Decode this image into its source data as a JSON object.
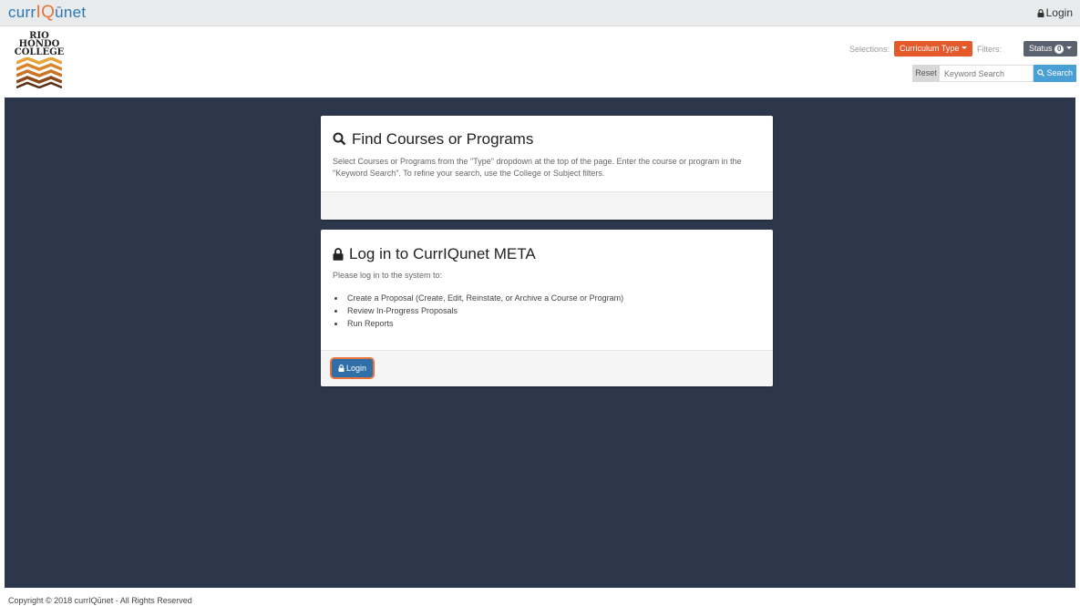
{
  "topbar": {
    "brand_prefix": "curr",
    "brand_accent": "IQ",
    "brand_suffix": "ūnet",
    "login_label": "Login"
  },
  "logo": {
    "line1": "RIO",
    "line2": "HONDO",
    "line3": "COLLEGE"
  },
  "toolbar": {
    "selections_label": "Selections:",
    "curriculum_type_label": "Curriculum Type",
    "filters_label": "Filters:",
    "status_label": "Status",
    "status_count": "0",
    "reset_label": "Reset",
    "search_placeholder": "Keyword Search",
    "search_label": "Search"
  },
  "find_card": {
    "title": "Find Courses or Programs",
    "body": "Select Courses or Programs from the \"Type\" dropdown at the top of the page. Enter the course or program in the \"Keyword Search\". To refine your search, use the College or Subject filters."
  },
  "login_card": {
    "title": "Log in to CurrIQunet META",
    "intro": "Please log in to the system to:",
    "items": [
      "Create a Proposal (Create, Edit, Reinstate, or Archive a Course or Program)",
      "Review In-Progress Proposals",
      "Run Reports"
    ],
    "login_label": "Login"
  },
  "footer": {
    "copyright": "Copyright © 2018 currIQūnet - All Rights Reserved"
  },
  "colors": {
    "brand_blue": "#2a79b5",
    "brand_orange": "#e8723b",
    "curriculum_button": "#e55a2b",
    "status_button": "#5a6270",
    "search_button": "#4aa0d5",
    "main_background": "#2d374c",
    "login_button": "#2d6fa6"
  },
  "icons": {
    "lock": "lock-icon",
    "search": "search-icon",
    "caret": "caret-down-icon"
  }
}
